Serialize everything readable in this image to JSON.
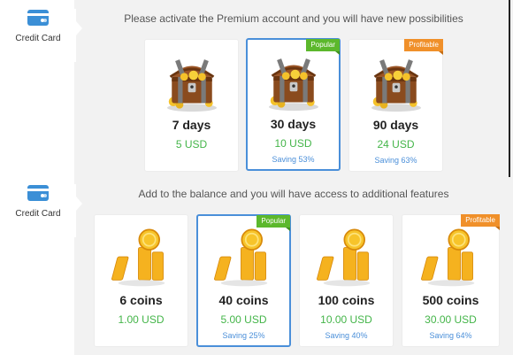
{
  "colors": {
    "accent": "#4a8fd9",
    "price": "#44b549",
    "popular": "#5cb82c",
    "profitable": "#f0902a"
  },
  "premium": {
    "tab_label": "Credit Card",
    "tab_icon": "credit-card-icon",
    "heading": "Please activate the Premium account and you will have new possibilities",
    "plans": [
      {
        "title": "7 days",
        "price": "5 USD",
        "saving": "",
        "badge": "",
        "icon": "treasure-chest-icon"
      },
      {
        "title": "30 days",
        "price": "10 USD",
        "saving": "Saving 53%",
        "badge": "Popular",
        "icon": "treasure-chest-icon"
      },
      {
        "title": "90 days",
        "price": "24 USD",
        "saving": "Saving 63%",
        "badge": "Profitable",
        "icon": "treasure-chest-icon"
      }
    ]
  },
  "balance": {
    "tab_label": "Credit Card",
    "tab_icon": "credit-card-icon",
    "heading": "Add to the balance and you will have access to additional features",
    "packs": [
      {
        "title": "6 coins",
        "price": "1.00 USD",
        "saving": "",
        "badge": "",
        "icon": "coin-stack-icon"
      },
      {
        "title": "40 coins",
        "price": "5.00 USD",
        "saving": "Saving 25%",
        "badge": "Popular",
        "icon": "coin-stack-icon"
      },
      {
        "title": "100 coins",
        "price": "10.00 USD",
        "saving": "Saving 40%",
        "badge": "",
        "icon": "coin-stack-icon"
      },
      {
        "title": "500 coins",
        "price": "30.00 USD",
        "saving": "Saving 64%",
        "badge": "Profitable",
        "icon": "coin-stack-icon"
      }
    ]
  }
}
